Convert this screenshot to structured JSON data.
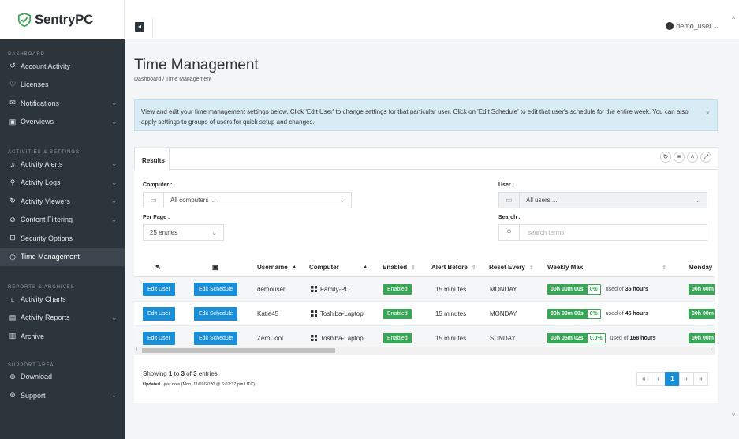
{
  "brand": {
    "name": "SentryPC"
  },
  "sidebar": {
    "sections": [
      {
        "title": "DASHBOARD"
      },
      {
        "title": "ACTIVITIES & SETTINGS"
      },
      {
        "title": "REPORTS & ARCHIVES"
      },
      {
        "title": "SUPPORT AREA"
      }
    ],
    "items": [
      {
        "label": "Account Activity",
        "icon": "history-icon"
      },
      {
        "label": "Licenses",
        "icon": "badge-icon"
      },
      {
        "label": "Notifications",
        "icon": "envelope-icon",
        "chevron": "⌄"
      },
      {
        "label": "Overviews",
        "icon": "calendar-icon",
        "chevron": "⌄"
      },
      {
        "label": "Activity Alerts",
        "icon": "bell-icon",
        "chevron": "⌄"
      },
      {
        "label": "Activity Logs",
        "icon": "search-icon",
        "chevron": "⌄"
      },
      {
        "label": "Activity Viewers",
        "icon": "refresh-icon",
        "chevron": "⌄"
      },
      {
        "label": "Content Filtering",
        "icon": "ban-icon",
        "chevron": "⌄"
      },
      {
        "label": "Security Options",
        "icon": "lock-icon"
      },
      {
        "label": "Time Management",
        "icon": "clock-icon"
      },
      {
        "label": "Activity Charts",
        "icon": "chart-icon"
      },
      {
        "label": "Activity Reports",
        "icon": "report-icon",
        "chevron": "⌄"
      },
      {
        "label": "Archive",
        "icon": "archive-icon"
      },
      {
        "label": "Download",
        "icon": "download-icon"
      },
      {
        "label": "Support",
        "icon": "lifebuoy-icon",
        "chevron": "⌄"
      }
    ]
  },
  "topbar": {
    "username": "demo_user",
    "caret": "⌄"
  },
  "page": {
    "title": "Time Management",
    "breadcrumb": "Dashboard  /  Time Management"
  },
  "alert": {
    "text": "View and edit your time management settings below.  Click 'Edit User' to change settings for that particular user.  Click on 'Edit Schedule' to edit that user's schedule for the entire week.  You can also apply settings to groups of users for quick setup and changes.",
    "close": "×"
  },
  "card": {
    "tab": "Results",
    "filters": {
      "computer_label": "Computer :",
      "computer_value": "All computers ...",
      "user_label": "User :",
      "user_value": "All users ...",
      "perpage_label": "Per Page :",
      "perpage_value": "25 entries",
      "search_label": "Search :",
      "search_placeholder": "search terms"
    },
    "table": {
      "headers": [
        "Username",
        "Computer",
        "Enabled",
        "Alert Before",
        "Reset Every",
        "Weekly Max",
        "Monday M"
      ],
      "edit_user_label": "Edit User",
      "edit_schedule_label": "Edit Schedule",
      "used_of_label": "used of",
      "rows": [
        {
          "username": "demouser",
          "computer": "Family-PC",
          "enabled": "Enabled",
          "alert_before": "15 minutes",
          "reset_every": "MONDAY",
          "weekly_time": "00h 00m 00s",
          "weekly_pct": "0%",
          "weekly_max": "35 hours",
          "monday": "00h 00m"
        },
        {
          "username": "Katie45",
          "computer": "Toshiba-Laptop",
          "enabled": "Enabled",
          "alert_before": "15 minutes",
          "reset_every": "MONDAY",
          "weekly_time": "00h 00m 00s",
          "weekly_pct": "0%",
          "weekly_max": "45 hours",
          "monday": "00h 00m"
        },
        {
          "username": "ZeroCool",
          "computer": "Toshiba-Laptop",
          "enabled": "Enabled",
          "alert_before": "15 minutes",
          "reset_every": "SUNDAY",
          "weekly_time": "00h 05m 02s",
          "weekly_pct": "0.0%",
          "weekly_max": "168 hours",
          "monday": "00h 00m"
        }
      ]
    },
    "footer": {
      "showing_prefix": "Showing ",
      "showing_from": "1",
      "showing_to_label": " to ",
      "showing_to": "3",
      "showing_of_label": " of ",
      "showing_total": "3",
      "showing_suffix": " entries",
      "updated_label": "Updated :",
      "updated_text": " just now (Mon, 11/09/2020 @ 6:01:37 pm UTC)"
    },
    "pager": {
      "first": "«",
      "prev": "‹",
      "current": "1",
      "next": "›",
      "last": "»"
    }
  },
  "colors": {
    "sidebar": "#2d353c",
    "primary": "#1a8ed6",
    "success": "#37a655",
    "alert_bg": "#d8ecf6"
  }
}
